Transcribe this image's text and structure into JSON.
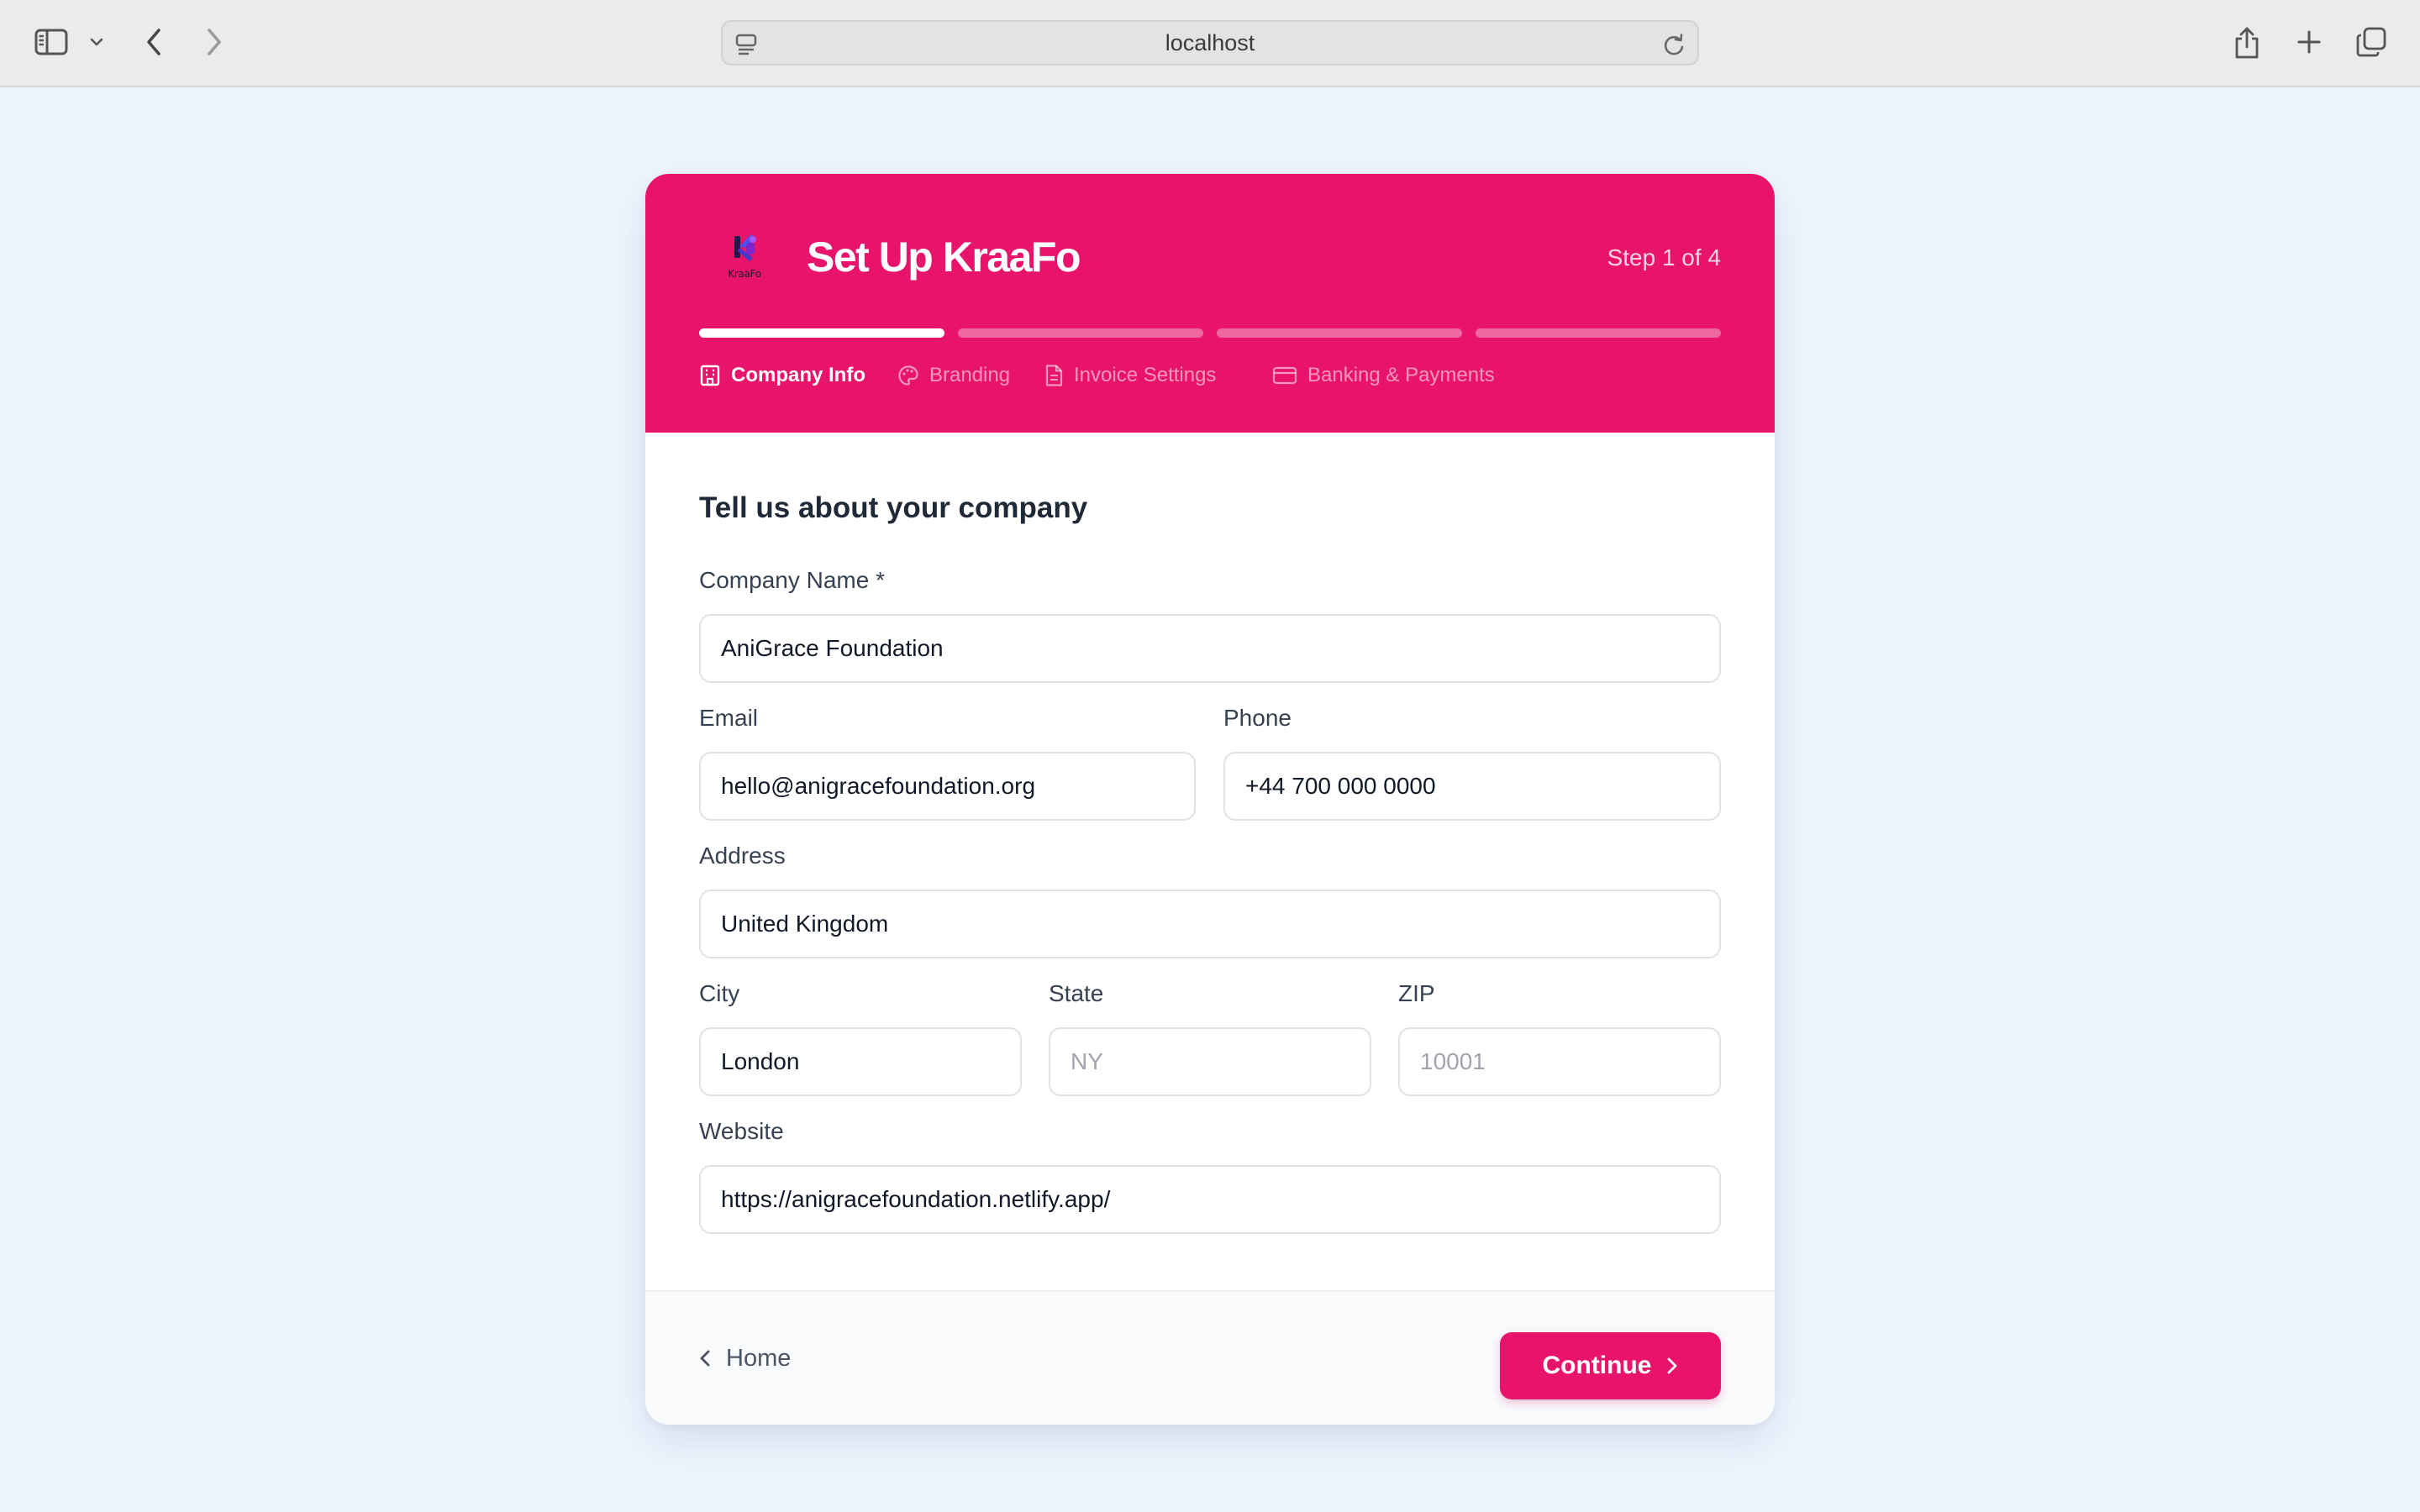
{
  "browser": {
    "url": "localhost",
    "icons": [
      "sidebar-icon",
      "chevron-down-icon",
      "back-arrow-icon",
      "forward-arrow-icon",
      "site-settings-icon",
      "reload-icon",
      "share-icon",
      "plus-icon",
      "tabs-overview-icon"
    ]
  },
  "header": {
    "logo_text": "KraaFo",
    "title": "Set Up KraaFo",
    "step_counter": "Step 1 of 4",
    "progress": {
      "current_step": 1,
      "total_steps": 4
    },
    "steps": [
      {
        "label": "Company Info",
        "icon": "building-icon",
        "active": true
      },
      {
        "label": "Branding",
        "icon": "palette-icon",
        "active": false
      },
      {
        "label": "Invoice Settings",
        "icon": "document-icon",
        "active": false
      },
      {
        "label": "Banking & Payments",
        "icon": "credit-card-icon",
        "active": false
      }
    ]
  },
  "form": {
    "title": "Tell us about your company",
    "company_name": {
      "label": "Company Name *",
      "value": "AniGrace Foundation",
      "placeholder": ""
    },
    "email": {
      "label": "Email",
      "value": "hello@anigracefoundation.org",
      "placeholder": ""
    },
    "phone": {
      "label": "Phone",
      "value": "+44 700 000 0000",
      "placeholder": ""
    },
    "address": {
      "label": "Address",
      "value": "United Kingdom",
      "placeholder": ""
    },
    "city": {
      "label": "City",
      "value": "London",
      "placeholder": ""
    },
    "state": {
      "label": "State",
      "value": "",
      "placeholder": "NY"
    },
    "zip": {
      "label": "ZIP",
      "value": "",
      "placeholder": "10001"
    },
    "website": {
      "label": "Website",
      "value": "https://anigracefoundation.netlify.app/",
      "placeholder": ""
    }
  },
  "footer": {
    "home_label": "Home",
    "continue_label": "Continue"
  },
  "colors": {
    "brand": "#e8146c",
    "page_background": "#eef5fe",
    "text_primary": "#1f2937"
  }
}
